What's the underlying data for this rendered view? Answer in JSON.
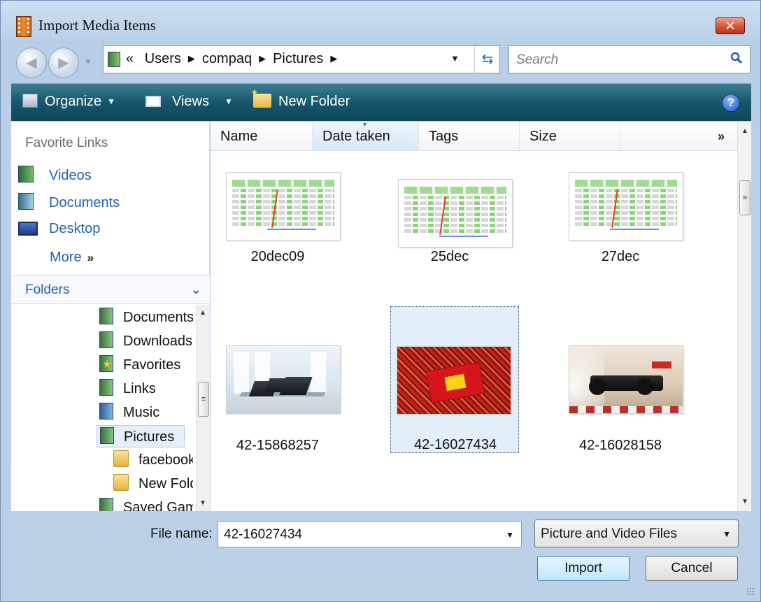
{
  "window": {
    "title": "Import Media Items"
  },
  "address": {
    "overflow": "«",
    "crumbs": [
      "Users",
      "compaq",
      "Pictures"
    ],
    "separator": "▶"
  },
  "search": {
    "placeholder": "Search"
  },
  "toolbar": {
    "organize": "Organize",
    "views": "Views",
    "new_folder": "New Folder",
    "help": "?"
  },
  "sidebar": {
    "favorites_title": "Favorite Links",
    "favorites": [
      {
        "label": "Videos",
        "icon": "videos-library-icon"
      },
      {
        "label": "Documents",
        "icon": "documents-library-icon"
      },
      {
        "label": "Desktop",
        "icon": "desktop-icon"
      }
    ],
    "more": "More",
    "more_glyph": "»",
    "folders_title": "Folders",
    "tree": [
      {
        "label": "Documents",
        "icon": "library",
        "selected": false
      },
      {
        "label": "Downloads",
        "icon": "library",
        "selected": false
      },
      {
        "label": "Favorites",
        "icon": "favorites",
        "selected": false
      },
      {
        "label": "Links",
        "icon": "library",
        "selected": false
      },
      {
        "label": "Music",
        "icon": "music",
        "selected": false
      },
      {
        "label": "Pictures",
        "icon": "library",
        "selected": true
      },
      {
        "label": "facebook",
        "icon": "folder",
        "selected": false
      },
      {
        "label": "New Folder",
        "icon": "folder",
        "selected": false
      },
      {
        "label": "Saved Games",
        "icon": "library",
        "selected": false
      }
    ]
  },
  "columns": [
    "Name",
    "Date taken",
    "Tags",
    "Size"
  ],
  "columns_more": "»",
  "files": [
    {
      "name": "20dec09",
      "thumb": "spreadsheet",
      "selected": false
    },
    {
      "name": "25dec",
      "thumb": "spreadsheet",
      "selected": false
    },
    {
      "name": "27dec",
      "thumb": "spreadsheet",
      "selected": false
    },
    {
      "name": "42-15868257",
      "thumb": "office-laptops",
      "selected": false
    },
    {
      "name": "42-16027434",
      "thumb": "ferrari-crowd",
      "selected": true
    },
    {
      "name": "42-16028158",
      "thumb": "race-car",
      "selected": false
    }
  ],
  "footer": {
    "file_name_label": "File name:",
    "file_name_value": "42-16027434",
    "file_type_value": "Picture and Video Files",
    "import_label": "Import",
    "cancel_label": "Cancel"
  }
}
